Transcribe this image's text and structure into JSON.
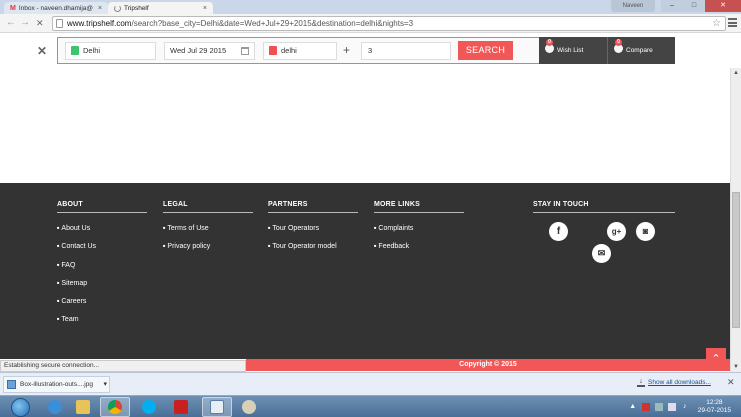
{
  "browser": {
    "tabs": [
      {
        "title": "Inbox - naveen.dhamija@"
      },
      {
        "title": "Tripshelf"
      }
    ],
    "window_user": "Naveen",
    "url_host": "www.tripshelf.com",
    "url_path": "/search?base_city=Delhi&date=Wed+Jul+29+2015&destination=delhi&nights=3"
  },
  "search_bar": {
    "from_city": "Delhi",
    "date": "Wed Jul 29 2015",
    "destination": "delhi",
    "nights": "3",
    "search_label": "SEARCH",
    "wishlist_label": "Wish List",
    "wishlist_count": "0",
    "compare_label": "Compare",
    "compare_count": "0"
  },
  "footer": {
    "about": {
      "heading": "ABOUT",
      "links": [
        "About Us",
        "Contact Us",
        "FAQ",
        "Sitemap",
        "Careers",
        "Team"
      ]
    },
    "legal": {
      "heading": "LEGAL",
      "links": [
        "Terms of Use",
        "Privacy policy"
      ]
    },
    "partners": {
      "heading": "PARTNERS",
      "links": [
        "Tour Operators",
        "Tour Operator model"
      ]
    },
    "more": {
      "heading": "MORE LINKS",
      "links": [
        "Complaints",
        "Feedback"
      ]
    },
    "stay": {
      "heading": "STAY IN TOUCH"
    },
    "copyright": "Copyright © 2015"
  },
  "status_text": "Establishing secure connection...",
  "downloads": {
    "file_name": "Box-illustration-outs....jpg",
    "show_all": "Show all downloads..."
  },
  "taskbar": {
    "time": "12:28",
    "date": "29-07-2015"
  },
  "colors": {
    "accent": "#f25757",
    "footer_bg": "#333333",
    "pin_green": "#3cc56b"
  }
}
